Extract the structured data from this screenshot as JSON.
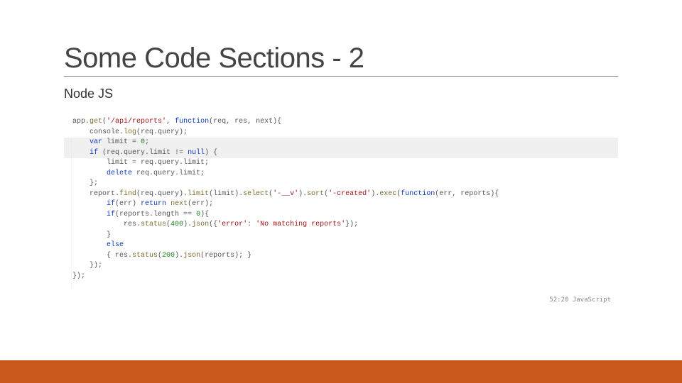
{
  "title": "Some Code Sections - 2",
  "subtitle": "Node JS",
  "code": {
    "lines": [
      {
        "hl": false,
        "segs": [
          [
            "app.",
            "var"
          ],
          [
            "get",
            "fn"
          ],
          [
            "(",
            "op"
          ],
          [
            "'/api/reports'",
            "str"
          ],
          [
            ", ",
            "op"
          ],
          [
            "function",
            "kw"
          ],
          [
            "(req, res, next){",
            "var"
          ]
        ]
      },
      {
        "hl": false,
        "segs": [
          [
            "    console.",
            "var"
          ],
          [
            "log",
            "fn"
          ],
          [
            "(req.query);",
            "var"
          ]
        ]
      },
      {
        "hl": true,
        "segs": [
          [
            "    ",
            "var"
          ],
          [
            "var",
            "kw"
          ],
          [
            " limit = ",
            "var"
          ],
          [
            "0",
            "num"
          ],
          [
            ";",
            "op"
          ]
        ]
      },
      {
        "hl": true,
        "segs": [
          [
            "    ",
            "var"
          ],
          [
            "if",
            "kw"
          ],
          [
            " (req.query.limit !=",
            "var"
          ],
          [
            " null",
            "kw"
          ],
          [
            ") {",
            "var"
          ]
        ]
      },
      {
        "hl": false,
        "segs": [
          [
            "        limit = req.query.limit;",
            "var"
          ]
        ]
      },
      {
        "hl": false,
        "segs": [
          [
            "        ",
            "var"
          ],
          [
            "delete",
            "kw"
          ],
          [
            " req.query.limit;",
            "var"
          ]
        ]
      },
      {
        "hl": false,
        "segs": [
          [
            "    };",
            "var"
          ]
        ]
      },
      {
        "hl": false,
        "segs": [
          [
            "",
            "var"
          ]
        ]
      },
      {
        "hl": false,
        "segs": [
          [
            "    report.",
            "var"
          ],
          [
            "find",
            "fn"
          ],
          [
            "(req.query).",
            "var"
          ],
          [
            "limit",
            "fn"
          ],
          [
            "(limit).",
            "var"
          ],
          [
            "select",
            "fn"
          ],
          [
            "(",
            "op"
          ],
          [
            "'-__v'",
            "str"
          ],
          [
            ").",
            "var"
          ],
          [
            "sort",
            "fn"
          ],
          [
            "(",
            "op"
          ],
          [
            "'-created'",
            "str"
          ],
          [
            ").",
            "var"
          ],
          [
            "exec",
            "fn"
          ],
          [
            "(",
            "op"
          ],
          [
            "function",
            "kw"
          ],
          [
            "(err, reports){",
            "var"
          ]
        ]
      },
      {
        "hl": false,
        "segs": [
          [
            "        ",
            "var"
          ],
          [
            "if",
            "kw"
          ],
          [
            "(err) ",
            "var"
          ],
          [
            "return",
            "kw"
          ],
          [
            " ",
            "var"
          ],
          [
            "next",
            "fn"
          ],
          [
            "(err);",
            "var"
          ]
        ]
      },
      {
        "hl": false,
        "segs": [
          [
            "",
            "var"
          ]
        ]
      },
      {
        "hl": false,
        "segs": [
          [
            "        ",
            "var"
          ],
          [
            "if",
            "kw"
          ],
          [
            "(reports.length == ",
            "var"
          ],
          [
            "0",
            "num"
          ],
          [
            "){",
            "var"
          ]
        ]
      },
      {
        "hl": false,
        "segs": [
          [
            "            res.",
            "var"
          ],
          [
            "status",
            "fn"
          ],
          [
            "(",
            "op"
          ],
          [
            "400",
            "num"
          ],
          [
            ").",
            "var"
          ],
          [
            "json",
            "fn"
          ],
          [
            "({",
            "var"
          ],
          [
            "'error'",
            "str"
          ],
          [
            ": ",
            "op"
          ],
          [
            "'No matching reports'",
            "str"
          ],
          [
            "});",
            "var"
          ]
        ]
      },
      {
        "hl": false,
        "segs": [
          [
            "        }",
            "var"
          ]
        ]
      },
      {
        "hl": false,
        "segs": [
          [
            "        ",
            "var"
          ],
          [
            "else",
            "kw"
          ]
        ]
      },
      {
        "hl": false,
        "segs": [
          [
            "        { res.",
            "var"
          ],
          [
            "status",
            "fn"
          ],
          [
            "(",
            "op"
          ],
          [
            "200",
            "num"
          ],
          [
            ").",
            "var"
          ],
          [
            "json",
            "fn"
          ],
          [
            "(reports); }",
            "var"
          ]
        ]
      },
      {
        "hl": false,
        "segs": [
          [
            "    });",
            "var"
          ]
        ]
      },
      {
        "hl": false,
        "segs": [
          [
            "});",
            "var"
          ]
        ]
      }
    ]
  },
  "status": "52:20   JavaScript"
}
